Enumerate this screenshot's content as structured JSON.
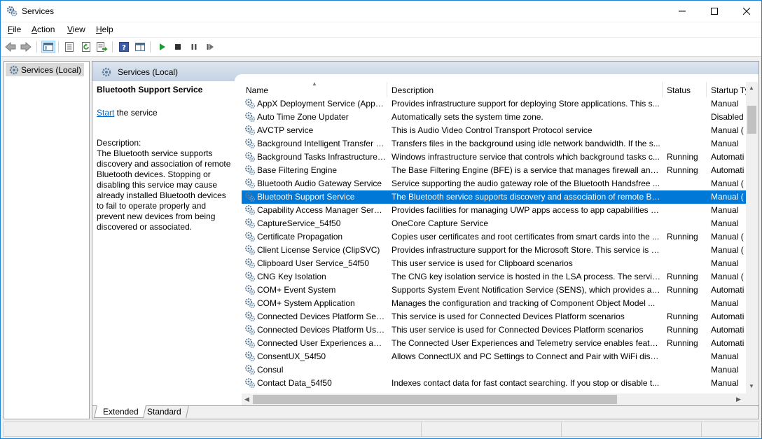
{
  "window": {
    "title": "Services",
    "minimize_icon": "minimize-icon",
    "maximize_icon": "maximize-icon",
    "close_icon": "close-icon"
  },
  "menu": {
    "items": [
      {
        "label": "File",
        "accel": "F",
        "rest": "ile"
      },
      {
        "label": "Action",
        "accel": "A",
        "rest": "ction"
      },
      {
        "label": "View",
        "accel": "V",
        "rest": "iew"
      },
      {
        "label": "Help",
        "accel": "H",
        "rest": "elp"
      }
    ]
  },
  "toolbar": {
    "icons": [
      "back-icon",
      "forward-icon",
      "show-hide-console-tree-icon",
      "properties-icon",
      "refresh-icon",
      "export-list-icon",
      "help-icon",
      "show-action-pane-icon",
      "start-service-icon",
      "stop-service-icon",
      "pause-service-icon",
      "restart-service-icon"
    ]
  },
  "tree": {
    "root_label": "Services (Local)"
  },
  "panel": {
    "header_label": "Services (Local)",
    "selected_service": "Bluetooth Support Service",
    "start_link": "Start",
    "start_suffix": " the service",
    "description_heading": "Description:",
    "description_text": "The Bluetooth service supports discovery and association of remote Bluetooth devices.  Stopping or disabling this service may cause already installed Bluetooth devices to fail to operate properly and prevent new devices from being discovered or associated."
  },
  "columns": {
    "name": "Name",
    "description": "Description",
    "status": "Status",
    "startup": "Startup Ty"
  },
  "services": [
    {
      "name": "AppX Deployment Service (AppX...",
      "description": "Provides infrastructure support for deploying Store applications. This s...",
      "status": "",
      "startup": "Manual"
    },
    {
      "name": "Auto Time Zone Updater",
      "description": "Automatically sets the system time zone.",
      "status": "",
      "startup": "Disabled"
    },
    {
      "name": "AVCTP service",
      "description": "This is Audio Video Control Transport Protocol service",
      "status": "",
      "startup": "Manual ("
    },
    {
      "name": "Background Intelligent Transfer S...",
      "description": "Transfers files in the background using idle network bandwidth. If the s...",
      "status": "",
      "startup": "Manual"
    },
    {
      "name": "Background Tasks Infrastructure ...",
      "description": "Windows infrastructure service that controls which background tasks c...",
      "status": "Running",
      "startup": "Automati"
    },
    {
      "name": "Base Filtering Engine",
      "description": "The Base Filtering Engine (BFE) is a service that manages firewall and I...",
      "status": "Running",
      "startup": "Automati"
    },
    {
      "name": "Bluetooth Audio Gateway Service",
      "description": "Service supporting the audio gateway role of the Bluetooth Handsfree ...",
      "status": "",
      "startup": "Manual ("
    },
    {
      "name": "Bluetooth Support Service",
      "description": "The Bluetooth service supports discovery and association of remote Bl...",
      "status": "",
      "startup": "Manual (",
      "selected": true
    },
    {
      "name": "Capability Access Manager Service",
      "description": "Provides facilities for managing UWP apps access to app capabilities a...",
      "status": "",
      "startup": "Manual"
    },
    {
      "name": "CaptureService_54f50",
      "description": "OneCore Capture Service",
      "status": "",
      "startup": "Manual"
    },
    {
      "name": "Certificate Propagation",
      "description": "Copies user certificates and root certificates from smart cards into the ...",
      "status": "Running",
      "startup": "Manual ("
    },
    {
      "name": "Client License Service (ClipSVC)",
      "description": "Provides infrastructure support for the Microsoft Store. This service is s...",
      "status": "",
      "startup": "Manual ("
    },
    {
      "name": "Clipboard User Service_54f50",
      "description": "This user service is used for Clipboard scenarios",
      "status": "",
      "startup": "Manual"
    },
    {
      "name": "CNG Key Isolation",
      "description": "The CNG key isolation service is hosted in the LSA process. The service...",
      "status": "Running",
      "startup": "Manual ("
    },
    {
      "name": "COM+ Event System",
      "description": "Supports System Event Notification Service (SENS), which provides aut...",
      "status": "Running",
      "startup": "Automati"
    },
    {
      "name": "COM+ System Application",
      "description": "Manages the configuration and tracking of Component Object Model ...",
      "status": "",
      "startup": "Manual"
    },
    {
      "name": "Connected Devices Platform Serv...",
      "description": "This service is used for Connected Devices Platform scenarios",
      "status": "Running",
      "startup": "Automati"
    },
    {
      "name": "Connected Devices Platform Use...",
      "description": "This user service is used for Connected Devices Platform scenarios",
      "status": "Running",
      "startup": "Automati"
    },
    {
      "name": "Connected User Experiences and ...",
      "description": "The Connected User Experiences and Telemetry service enables feature...",
      "status": "Running",
      "startup": "Automati"
    },
    {
      "name": "ConsentUX_54f50",
      "description": "Allows ConnectUX and PC Settings to Connect and Pair with WiFi displ...",
      "status": "",
      "startup": "Manual"
    },
    {
      "name": "Consul",
      "description": "",
      "status": "",
      "startup": "Manual"
    },
    {
      "name": "Contact Data_54f50",
      "description": "Indexes contact data for fast contact searching. If you stop or disable t...",
      "status": "",
      "startup": "Manual"
    }
  ],
  "tabs": [
    {
      "label": "Extended",
      "active": true
    },
    {
      "label": "Standard",
      "active": false
    }
  ],
  "colors": {
    "selection": "#0078d7",
    "link": "#0066cc",
    "window_border": "#1883d7"
  }
}
